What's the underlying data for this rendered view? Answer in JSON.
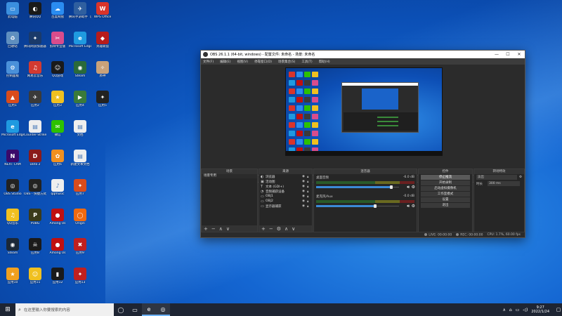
{
  "desktop": {
    "icons": [
      {
        "label": "此电脑",
        "color": "#3b8fdf",
        "glyph": "▭",
        "col": 0,
        "row": 0
      },
      {
        "label": "腾讯QQ",
        "color": "#1a1a1a",
        "glyph": "◐",
        "col": 1,
        "row": 0
      },
      {
        "label": "百度网盘",
        "color": "#2a8cf0",
        "glyph": "☁",
        "col": 2,
        "row": 0
      },
      {
        "label": "腾讯手游助手（腾讯网游加速）",
        "color": "#2f5f9f",
        "glyph": "✈",
        "col": 3,
        "row": 0
      },
      {
        "label": "WPS Office",
        "color": "#d9342b",
        "glyph": "W",
        "col": 4,
        "row": 0
      },
      {
        "label": "回收站",
        "color": "#5f8fbf",
        "glyph": "♻",
        "col": 0,
        "row": 1
      },
      {
        "label": "腾讯网游加速器",
        "color": "#1a3a6a",
        "glyph": "✦",
        "col": 1,
        "row": 1
      },
      {
        "label": "剪映专业版",
        "color": "#d94c8c",
        "glyph": "✂",
        "col": 2,
        "row": 1
      },
      {
        "label": "Microsoft Edge",
        "color": "#1f9ae0",
        "glyph": "e",
        "col": 3,
        "row": 1
      },
      {
        "label": "英雄联盟",
        "color": "#b71c1c",
        "glyph": "◆",
        "col": 4,
        "row": 1
      },
      {
        "label": "控制面板",
        "color": "#4a90d9",
        "glyph": "⚙",
        "col": 0,
        "row": 2
      },
      {
        "label": "网易云音乐",
        "color": "#d33a31",
        "glyph": "♫",
        "col": 1,
        "row": 2
      },
      {
        "label": "QQ游戏",
        "color": "#1a1a1a",
        "glyph": "☺",
        "col": 2,
        "row": 2
      },
      {
        "label": "Steam",
        "color": "#2a6a3a",
        "glyph": "◉",
        "col": 3,
        "row": 2
      },
      {
        "label": "原神",
        "color": "#c9a27a",
        "glyph": "✧",
        "col": 4,
        "row": 2
      },
      {
        "label": "应用1",
        "color": "#d94c1c",
        "glyph": "▲",
        "col": 0,
        "row": 3
      },
      {
        "label": "应用2",
        "color": "#3a3a3a",
        "glyph": "✈",
        "col": 1,
        "row": 3
      },
      {
        "label": "应用3",
        "color": "#f0c020",
        "glyph": "★",
        "col": 2,
        "row": 3
      },
      {
        "label": "应用4",
        "color": "#3a7a3a",
        "glyph": "▶",
        "col": 3,
        "row": 3
      },
      {
        "label": "应用5",
        "color": "#222",
        "glyph": "✦",
        "col": 4,
        "row": 3
      },
      {
        "label": "Microsoft Edge",
        "color": "#1f9ae0",
        "glyph": "e",
        "col": 0,
        "row": 4
      },
      {
        "label": "Counter-Strike",
        "color": "#eeeeee",
        "glyph": "▤",
        "col": 1,
        "row": 4
      },
      {
        "label": "微信",
        "color": "#2dc100",
        "glyph": "✉",
        "col": 2,
        "row": 4
      },
      {
        "label": "文档",
        "color": "#eeeeee",
        "glyph": "▤",
        "col": 3,
        "row": 4
      },
      {
        "label": "NEXT CAM",
        "color": "#3a0a6a",
        "glyph": "N",
        "col": 0,
        "row": 5
      },
      {
        "label": "Dota 2",
        "color": "#8a1a1a",
        "glyph": "D",
        "col": 1,
        "row": 5
      },
      {
        "label": "应用6",
        "color": "#f09020",
        "glyph": "✿",
        "col": 2,
        "row": 5
      },
      {
        "label": "新建文本文档",
        "color": "#eeeeee",
        "glyph": "▤",
        "col": 3,
        "row": 5
      },
      {
        "label": "OBS Studio",
        "color": "#222",
        "glyph": "◎",
        "col": 0,
        "row": 6
      },
      {
        "label": "OBS - 快捷方式",
        "color": "#222",
        "glyph": "◎",
        "col": 1,
        "row": 6
      },
      {
        "label": "qqmusic",
        "color": "#eeeeee",
        "glyph": "♪",
        "col": 2,
        "row": 6
      },
      {
        "label": "应用7",
        "color": "#d94c1c",
        "glyph": "✦",
        "col": 3,
        "row": 6
      },
      {
        "label": "QQ音乐",
        "color": "#f0c020",
        "glyph": "♫",
        "col": 0,
        "row": 7
      },
      {
        "label": "PUBG",
        "color": "#3a3a1a",
        "glyph": "P",
        "col": 1,
        "row": 7
      },
      {
        "label": "Among Us",
        "color": "#c01010",
        "glyph": "●",
        "col": 2,
        "row": 7
      },
      {
        "label": "Origin",
        "color": "#f06a10",
        "glyph": "◯",
        "col": 3,
        "row": 7
      },
      {
        "label": "Steam",
        "color": "#1b2838",
        "glyph": "◉",
        "col": 0,
        "row": 8
      },
      {
        "label": "应用8",
        "color": "#1a1a1a",
        "glyph": "☠",
        "col": 1,
        "row": 8
      },
      {
        "label": "Among Us",
        "color": "#c01010",
        "glyph": "●",
        "col": 2,
        "row": 8
      },
      {
        "label": "应用9",
        "color": "#c02020",
        "glyph": "✖",
        "col": 3,
        "row": 8
      },
      {
        "label": "应用10",
        "color": "#f0a020",
        "glyph": "★",
        "col": 0,
        "row": 9
      },
      {
        "label": "应用11",
        "color": "#f0c020",
        "glyph": "☺",
        "col": 1,
        "row": 9
      },
      {
        "label": "应用12",
        "color": "#1a1a1a",
        "glyph": "▮",
        "col": 2,
        "row": 9
      },
      {
        "label": "应用13",
        "color": "#c02020",
        "glyph": "✦",
        "col": 3,
        "row": 9
      }
    ]
  },
  "obs": {
    "title": "OBS 26.1.1 (64-bit, windows) - 配置文件: 未命名 - 场景: 未命名",
    "window_buttons": [
      "—",
      "☐",
      "✕"
    ],
    "menu": [
      "文件(F)",
      "编辑(E)",
      "视图(V)",
      "停靠窗口(D)",
      "场景集合(S)",
      "工具(T)",
      "帮助(H)"
    ],
    "source_bar": {
      "label": "未选择源",
      "props": "⚙ 属性",
      "filters": "⧉ 滤镜"
    },
    "docks": {
      "scenes": {
        "title": "场景",
        "items": [
          "场景专用"
        ]
      },
      "sources": {
        "title": "来源",
        "items": [
          {
            "icon": "◐",
            "name": "浏览器"
          },
          {
            "icon": "▣",
            "name": "活动图"
          },
          {
            "icon": "T",
            "name": "文本 (GDI+)"
          },
          {
            "icon": "◔",
            "name": "音频捕获设备"
          },
          {
            "icon": "▭",
            "name": "OBJ1"
          },
          {
            "icon": "▭",
            "name": "OBJ2"
          },
          {
            "icon": "▭",
            "name": "显示器捕获"
          }
        ]
      },
      "mixer": {
        "title": "混音器",
        "channels": [
          {
            "name": "桌面音频",
            "db": "-6.0 dB",
            "level": 0.91
          },
          {
            "name": "麦克风/Aux",
            "db": "-0.0 dB",
            "level": 0.71
          }
        ]
      },
      "controls": {
        "title": "控件",
        "buttons": [
          "停止推流",
          "开始录制",
          "启动虚拟摄像机",
          "工作室模式",
          "设置",
          "退出"
        ]
      },
      "transitions": {
        "title": "转场特效",
        "type": "淡出",
        "duration_label": "时长",
        "duration": "300 ms"
      }
    },
    "footer_icons": [
      "+",
      "−",
      "∧",
      "∨"
    ],
    "footer_icons_src": [
      "+",
      "−",
      "⚙",
      "∧",
      "∨"
    ],
    "status": {
      "live": "LIVE: 00:00:00",
      "rec": "REC: 00:00:00",
      "cpu": "CPU: 1.7%, 60.00 fps"
    }
  },
  "taskbar": {
    "start_icon": "⊞",
    "search_placeholder": "在这里输入你要搜索的内容",
    "apps": [
      {
        "name": "task-view-icon",
        "glyph": "◯"
      },
      {
        "name": "file-explorer-icon",
        "glyph": "▭"
      },
      {
        "name": "edge-icon",
        "glyph": "e"
      },
      {
        "name": "obs-icon",
        "glyph": "◎"
      }
    ],
    "time": "9:27",
    "date": "2022/1/24",
    "tray_icons": [
      "∧",
      "⌂",
      "▭",
      "◁)"
    ]
  }
}
